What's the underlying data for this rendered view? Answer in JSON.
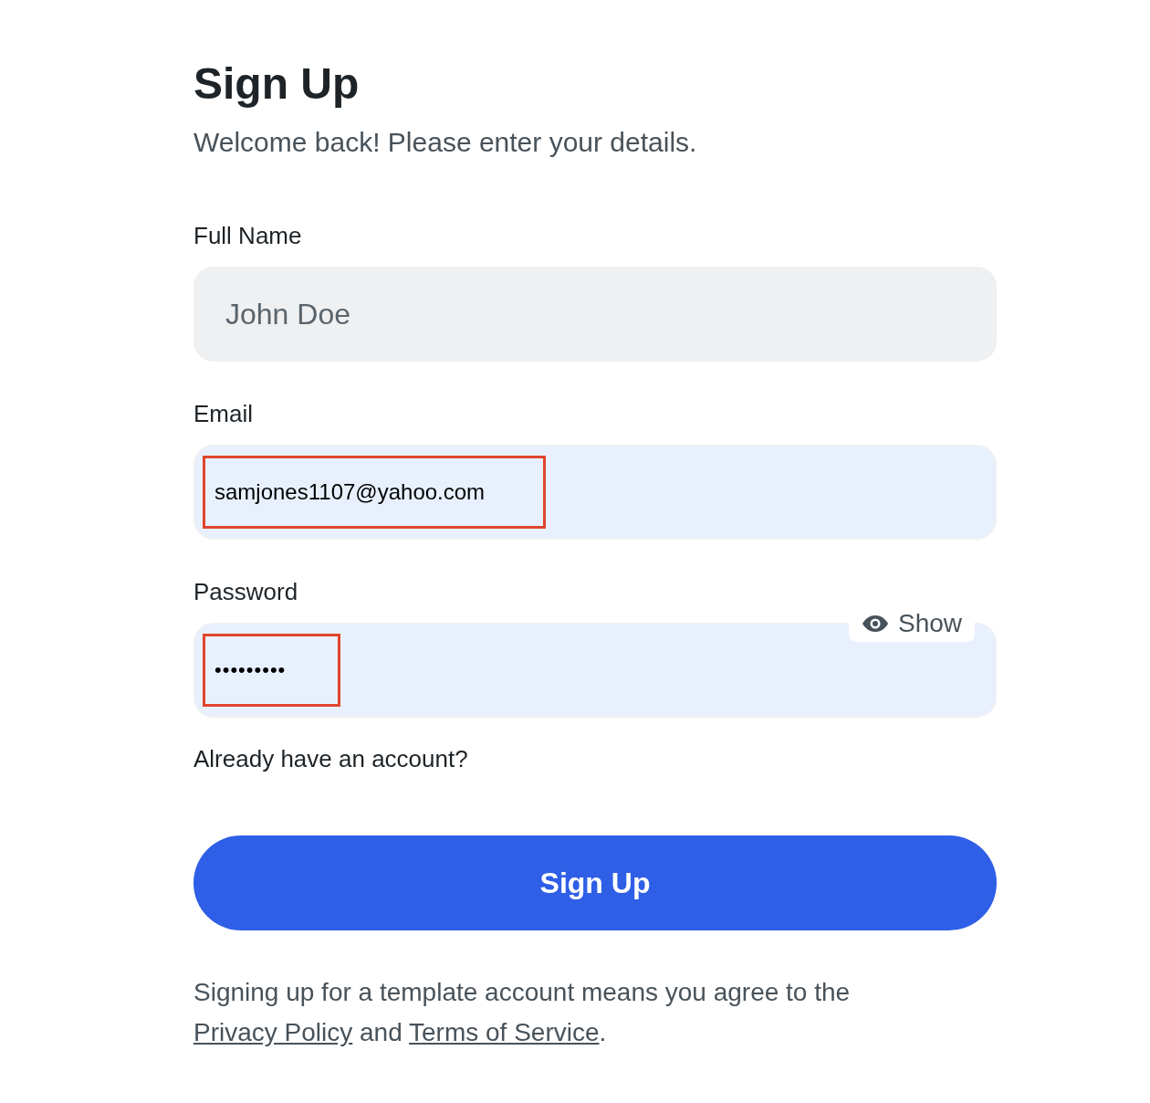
{
  "title": "Sign Up",
  "subtitle": "Welcome back! Please enter your details.",
  "fields": [
    {
      "label": "Full Name",
      "placeholder": "John Doe",
      "autofilled": false,
      "highlighted": false
    },
    {
      "label": "Email",
      "value": "samjones1107@yahoo.com",
      "autofilled": true,
      "highlighted": true
    },
    {
      "label": "Password",
      "value": "•••••••••",
      "autofilled": true,
      "highlighted": true,
      "toggle": "Show"
    }
  ],
  "account_prompt": "Already have an account?",
  "submit": "Sign Up",
  "terms": [
    {
      "kind": "text",
      "text": "Signing up for a template account means you agree to the "
    },
    {
      "kind": "link",
      "text": "Privacy Policy"
    },
    {
      "kind": "text",
      "text": " and "
    },
    {
      "kind": "link",
      "text": "Terms of Service"
    },
    {
      "kind": "text",
      "text": "."
    }
  ]
}
